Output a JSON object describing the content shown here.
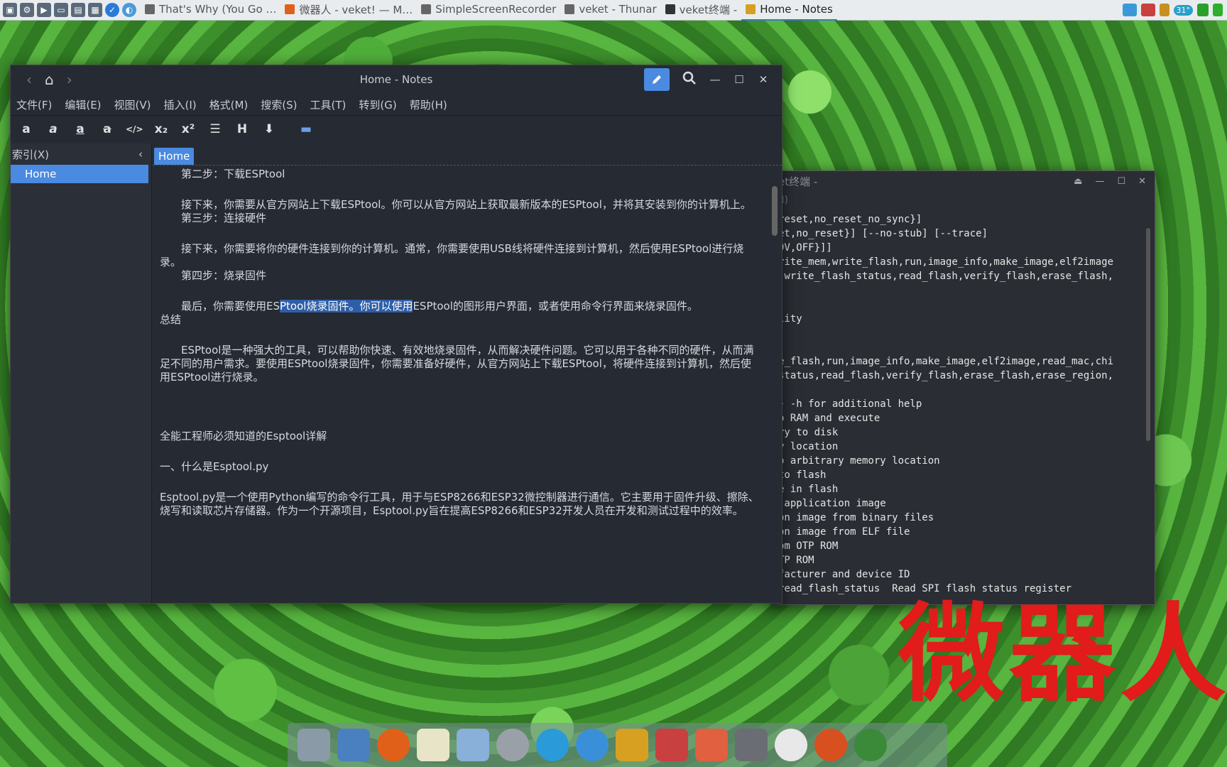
{
  "taskbar": {
    "tasks": [
      {
        "label": "That's Why (You Go …",
        "active": false
      },
      {
        "label": "微器人 - veket! — M…",
        "active": false
      },
      {
        "label": "SimpleScreenRecorder",
        "active": false
      },
      {
        "label": "veket - Thunar",
        "active": false
      },
      {
        "label": "veket终端 -",
        "active": false
      },
      {
        "label": "Home - Notes",
        "active": true
      }
    ],
    "tray": {
      "temp": "31°"
    }
  },
  "terminal": {
    "title": "et终端 -",
    "menu": "H)",
    "lines": [
      "reset,no_reset_no_sync}]",
      "et,no_reset}] [--no-stub] [--trace]",
      "9V,OFF}]]",
      "rite_mem,write_flash,run,image_info,make_image,elf2image",
      ",write_flash_status,read_flash,verify_flash,erase_flash,",
      "",
      "",
      "lity",
      "",
      "",
      "e_flash,run,image_info,make_image,elf2image,read_mac,chi",
      "status,read_flash,verify_flash,erase_flash,erase_region,",
      "",
      "} -h for additional help",
      "o RAM and execute",
      "ry to disk",
      "y location",
      "o arbitrary memory location",
      "to flash",
      "e in flash",
      " application image",
      "on image from binary files",
      "on image from ELF file",
      "om OTP ROM",
      "TP ROM",
      "facturer and device ID",
      "read_flash_status  Read SPI flash status register"
    ]
  },
  "notes": {
    "title": "Home - Notes",
    "menu": [
      "文件(F)",
      "编辑(E)",
      "视图(V)",
      "插入(I)",
      "格式(M)",
      "搜索(S)",
      "工具(T)",
      "转到(G)",
      "帮助(H)"
    ],
    "toolbar": [
      "a",
      "a",
      "a",
      "a",
      "</>",
      "x₂",
      "x²",
      "☰",
      "H",
      "⬇"
    ],
    "sidebar": {
      "header": "索引(X)",
      "items": [
        "Home"
      ]
    },
    "tab": "Home",
    "doc": {
      "step2_title": "第二步：下载ESPtool",
      "step2_body": "接下来，你需要从官方网站上下载ESPtool。你可以从官方网站上获取最新版本的ESPtool，并将其安装到你的计算机上。",
      "step3_title": "第三步：连接硬件",
      "step3_body": "接下来，你需要将你的硬件连接到你的计算机。通常，你需要使用USB线将硬件连接到计算机，然后使用ESPtool进行烧录。",
      "step4_title": "第四步：烧录固件",
      "step4_body_pre": "最后，你需要使用ES",
      "step4_body_sel": "Ptool烧录固件。你可以使用",
      "step4_body_post": "ESPtool的图形用户界面，或者使用命令行界面来烧录固件。",
      "summary_title": "总结",
      "summary_body": "ESPtool是一种强大的工具，可以帮助你快速、有效地烧录固件，从而解决硬件问题。它可以用于各种不同的硬件，从而满足不同的用户需求。要使用ESPtool烧录固件，你需要准备好硬件，从官方网站上下载ESPtool，将硬件连接到计算机，然后使用ESPtool进行烧录。",
      "article_title": "全能工程师必须知道的Esptool详解",
      "section1_title": "一、什么是Esptool.py",
      "section1_body": "Esptool.py是一个使用Python编写的命令行工具，用于与ESP8266和ESP32微控制器进行通信。它主要用于固件升级、擦除、烧写和读取芯片存储器。作为一个开源项目，Esptool.py旨在提高ESP8266和ESP32开发人员在开发和测试过程中的效率。"
    }
  },
  "overlay": {
    "big_text": "微器人"
  }
}
